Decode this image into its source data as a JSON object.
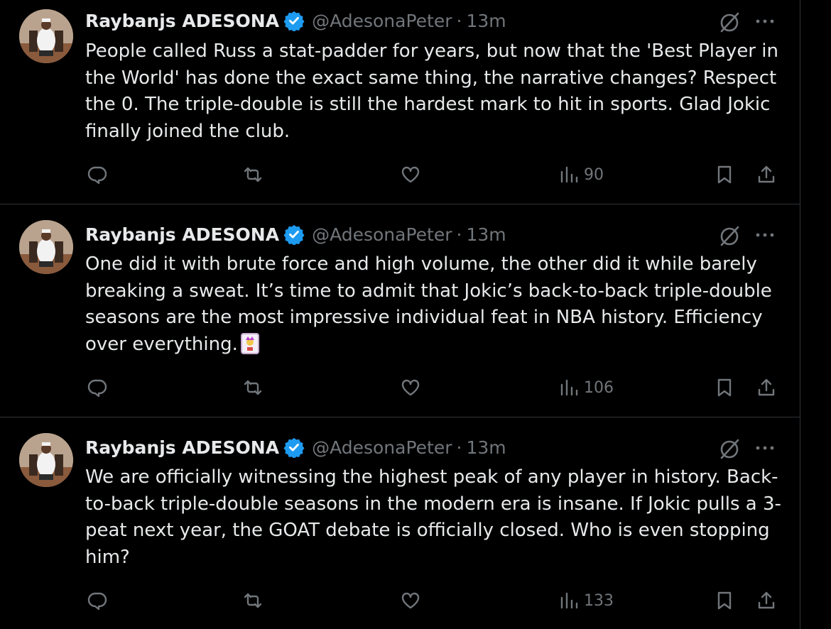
{
  "tweets": [
    {
      "author": "Raybanjs ADESONA",
      "handle": "@AdesonaPeter",
      "separator": "·",
      "time": "13m",
      "text": "People called Russ a stat-padder for years, but now that the 'Best Player in the World' has done the exact same thing, the narrative changes? Respect the 0. The triple-double is still the hardest mark to hit in sports. Glad Jokic finally joined the club.",
      "emoji": "",
      "views": "90"
    },
    {
      "author": "Raybanjs ADESONA",
      "handle": "@AdesonaPeter",
      "separator": "·",
      "time": "13m",
      "text": "One did it with brute force and high volume, the other did it while barely breaking a sweat. It’s time to admit that Jokic’s back-to-back triple-double seasons are the most impressive individual feat in NBA history. Efficiency over everything.",
      "emoji": "🃏",
      "views": "106"
    },
    {
      "author": "Raybanjs ADESONA",
      "handle": "@AdesonaPeter",
      "separator": "·",
      "time": "13m",
      "text": "We are officially witnessing the highest peak of any player in history. Back-to-back triple-double seasons in the modern era is insane. If Jokic pulls a 3-peat next year, the GOAT debate is officially closed. Who is even stopping him?",
      "emoji": "",
      "views": "133"
    }
  ],
  "icons": {
    "verified": "verified-badge-icon",
    "grok": "grok-icon",
    "more": "more-icon",
    "reply": "reply-icon",
    "retweet": "retweet-icon",
    "like": "heart-icon",
    "views": "views-icon",
    "bookmark": "bookmark-icon",
    "share": "share-icon"
  },
  "colors": {
    "background": "#000000",
    "text": "#e7e9ea",
    "secondary": "#71767b",
    "verified": "#1d9bf0",
    "border": "#2f3336"
  }
}
